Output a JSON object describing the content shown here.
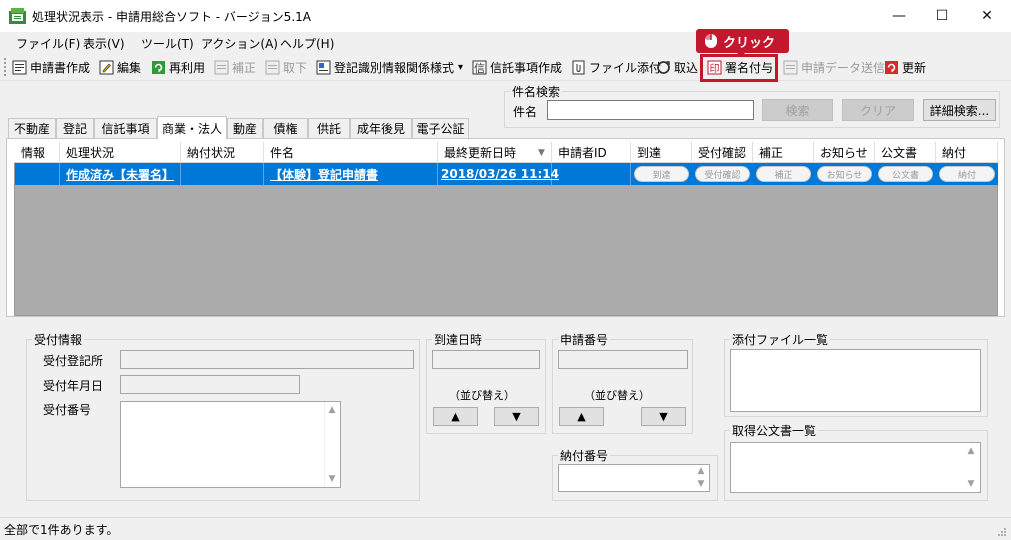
{
  "window": {
    "title": "処理状況表示 - 申請用総合ソフト - バージョン5.1A",
    "minimize_glyph": "—",
    "maximize_glyph": "☐",
    "close_glyph": "✕"
  },
  "menu": [
    "ファイル(F)",
    "表示(V)",
    "ツール(T)",
    "アクション(A)",
    "ヘルプ(H)"
  ],
  "toolbar": {
    "items": [
      {
        "label": "申請書作成",
        "icon": "new-document-icon",
        "enabled": true
      },
      {
        "label": "編集",
        "icon": "edit-icon",
        "enabled": true
      },
      {
        "label": "再利用",
        "icon": "reuse-icon",
        "enabled": true
      },
      {
        "label": "補正",
        "icon": "amend-icon",
        "enabled": false
      },
      {
        "label": "取下",
        "icon": "withdraw-icon",
        "enabled": false
      },
      {
        "label": "登記識別情報関係様式",
        "icon": "form-icon",
        "enabled": true,
        "dropdown_glyph": "▾"
      },
      {
        "label": "信託事項作成",
        "icon": "trust-icon",
        "enabled": true
      },
      {
        "label": "ファイル添付",
        "icon": "attach-icon",
        "enabled": true
      },
      {
        "label": "取込",
        "icon": "import-icon",
        "enabled": true
      },
      {
        "label": "署名付与",
        "icon": "signature-icon",
        "enabled": true
      },
      {
        "label": "申請データ送信",
        "icon": "send-icon",
        "enabled": false
      },
      {
        "label": "更新",
        "icon": "refresh-icon",
        "enabled": true
      }
    ]
  },
  "callout": {
    "label": "クリック",
    "icon": "mouse-click-icon"
  },
  "search": {
    "group_label": "件名検索",
    "field_label": "件名",
    "value": "",
    "search_button": "検索",
    "clear_button": "クリア",
    "advanced_button": "詳細検索..."
  },
  "tabs": [
    "不動産",
    "登記",
    "信託事項",
    "商業・法人",
    "動産",
    "債権",
    "供託",
    "成年後見",
    "電子公証"
  ],
  "active_tab": "商業・法人",
  "grid": {
    "sort_glyph": "▼",
    "columns": [
      "情報",
      "処理状況",
      "納付状況",
      "件名",
      "最終更新日時",
      "申請者ID",
      "到達",
      "受付確認",
      "補正",
      "お知らせ",
      "公文書",
      "納付"
    ],
    "rows": [
      {
        "info": "",
        "status": "作成済み【未署名】",
        "payment_status": "",
        "subject": "【体験】登記申請書",
        "updated": "2018/03/26 11:14",
        "applicant_id": "",
        "buttons": [
          "到達",
          "受付確認",
          "補正",
          "お知らせ",
          "公文書",
          "納付"
        ]
      }
    ]
  },
  "receipt": {
    "group_label": "受付情報",
    "office_label": "受付登記所",
    "date_label": "受付年月日",
    "number_label": "受付番号"
  },
  "arrival": {
    "group_label": "到達日時",
    "sort_label": "（並び替え）",
    "up": "▲",
    "down": "▼"
  },
  "application": {
    "group_label": "申請番号",
    "sort_label": "（並び替え）",
    "up": "▲",
    "down": "▼"
  },
  "payment": {
    "group_label": "納付番号"
  },
  "attachments": {
    "group_label": "添付ファイル一覧"
  },
  "documents": {
    "group_label": "取得公文書一覧"
  },
  "scroll": {
    "up": "▲",
    "down": "▼"
  },
  "status": {
    "text": "全部で1件あります。"
  },
  "colors": {
    "accent": "#c3172d",
    "selection": "#0078d7",
    "grid_bg": "#ababab"
  }
}
